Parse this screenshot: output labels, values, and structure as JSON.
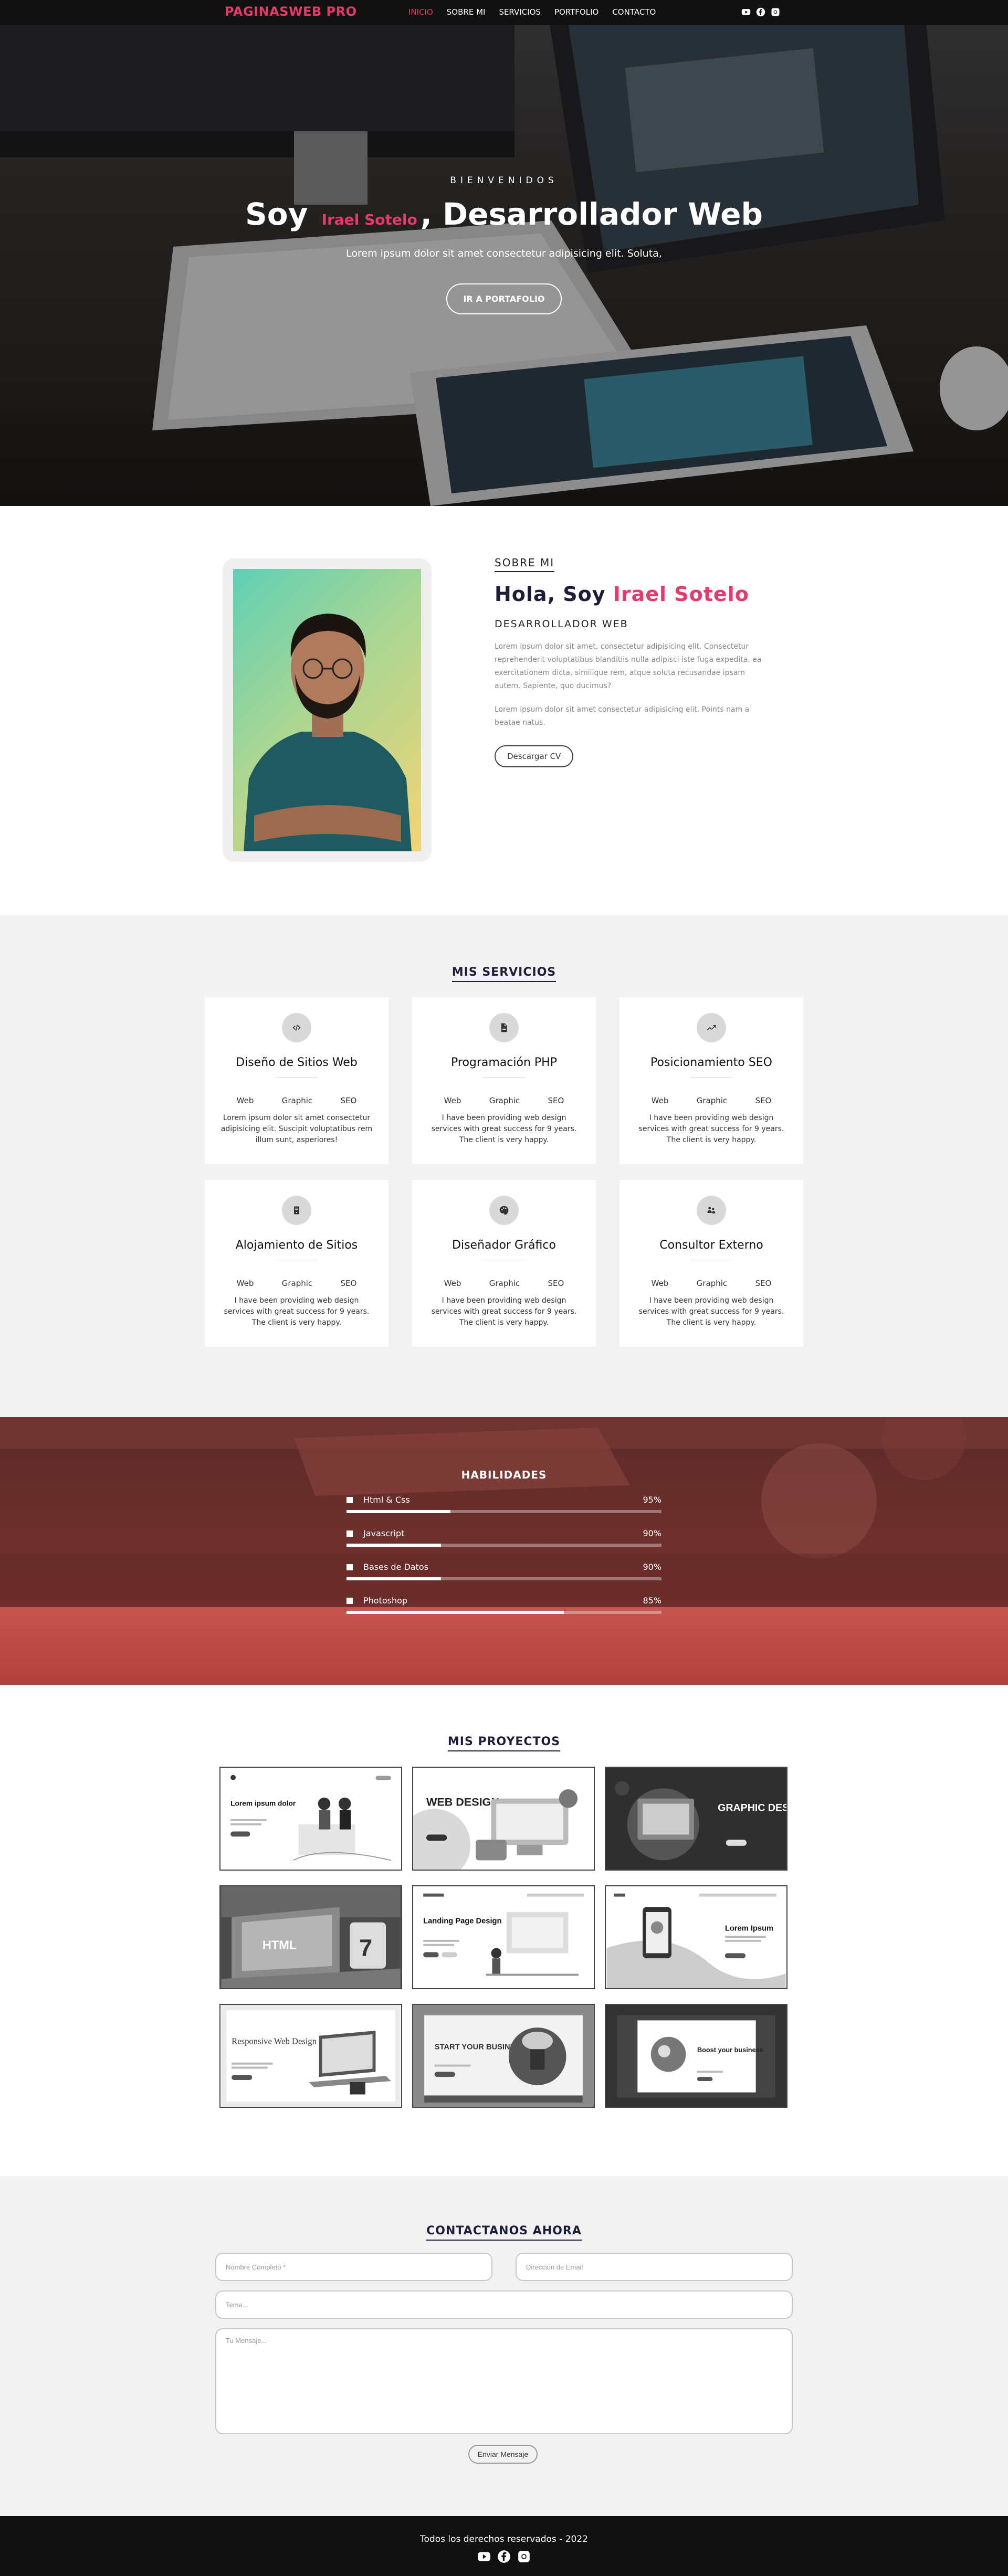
{
  "nav": {
    "brand": "PAGINASWEB PRO",
    "items": [
      {
        "label": "INICIO",
        "active": true
      },
      {
        "label": "SOBRE MI",
        "active": false
      },
      {
        "label": "SERVICIOS",
        "active": false
      },
      {
        "label": "PORTFOLIO",
        "active": false
      },
      {
        "label": "CONTACTO",
        "active": false
      }
    ],
    "social_icons": [
      "youtube-icon",
      "facebook-icon",
      "instagram-icon"
    ]
  },
  "hero": {
    "kicker": "BIENVENIDOS",
    "title_prefix": "Soy",
    "title_name": "Irael Sotelo",
    "title_suffix": ", Desarrollador Web",
    "subtitle": "Lorem ipsum dolor sit amet consectetur adipisicing elit. Soluta,",
    "button": "IR A PORTAFOLIO"
  },
  "about": {
    "kicker": "SOBRE MI",
    "hello_prefix": "Hola, Soy",
    "hello_name": "Irael Sotelo",
    "role": "DESARROLLADOR WEB",
    "paragraph1": "Lorem ipsum dolor sit amet, consectetur adipisicing elit. Consectetur reprehenderit voluptatibus blanditiis nulla adipisci iste fuga expedita, ea exercitationem dicta, similique rem, atque soluta recusandae ipsam autem. Sapiente, quo ducimus?",
    "paragraph2": "Lorem ipsum dolor sit amet consectetur adipisicing elit. Points nam a beatae natus.",
    "button": "Descargar CV"
  },
  "services": {
    "title": "MIS SERVICIOS",
    "items": [
      {
        "icon": "code-icon",
        "title": "Diseño de Sitios Web",
        "tags": [
          "Web",
          "Graphic",
          "SEO"
        ],
        "desc": "Lorem ipsum dolor sit amet consectetur adipisicing elit. Suscipit voluptatibus rem illum sunt, asperiores!"
      },
      {
        "icon": "file-icon",
        "title": "Programación PHP",
        "tags": [
          "Web",
          "Graphic",
          "SEO"
        ],
        "desc": "I have been providing web design services with great success for 9 years. The client is very happy."
      },
      {
        "icon": "trend-icon",
        "title": "Posicionamiento SEO",
        "tags": [
          "Web",
          "Graphic",
          "SEO"
        ],
        "desc": "I have been providing web design services with great success for 9 years. The client is very happy."
      },
      {
        "icon": "server-icon",
        "title": "Alojamiento de Sitios",
        "tags": [
          "Web",
          "Graphic",
          "SEO"
        ],
        "desc": "I have been providing web design services with great success for 9 years. The client is very happy."
      },
      {
        "icon": "palette-icon",
        "title": "Diseñador Gráfico",
        "tags": [
          "Web",
          "Graphic",
          "SEO"
        ],
        "desc": "I have been providing web design services with great success for 9 years. The client is very happy."
      },
      {
        "icon": "users-icon",
        "title": "Consultor Externo",
        "tags": [
          "Web",
          "Graphic",
          "SEO"
        ],
        "desc": "I have been providing web design services with great success for 9 years. The client is very happy."
      }
    ]
  },
  "skills": {
    "title": "HABILIDADES",
    "items": [
      {
        "label": "Html & Css",
        "value": "95%",
        "fraction": 0.33
      },
      {
        "label": "Javascript",
        "value": "90%",
        "fraction": 0.3
      },
      {
        "label": "Bases de Datos",
        "value": "90%",
        "fraction": 0.3
      },
      {
        "label": "Photoshop",
        "value": "85%",
        "fraction": 0.69
      }
    ]
  },
  "projects": {
    "title": "MIS PROYECTOS",
    "items": [
      {
        "heading": "Lorem ipsum dolor"
      },
      {
        "heading": "WEB DESIGN"
      },
      {
        "heading": "GRAPHIC DESIGN"
      },
      {
        "heading": "HTML"
      },
      {
        "heading": "Landing Page Design"
      },
      {
        "heading": "Lorem Ipsum"
      },
      {
        "heading": "Responsive Web Design"
      },
      {
        "heading": "START YOUR BUSINESS"
      },
      {
        "heading": "Boost your business"
      }
    ]
  },
  "contact": {
    "title": "CONTACTANOS AHORA",
    "name_placeholder": "Nombre Completo *",
    "email_placeholder": "Dirección de Email",
    "subject_placeholder": "Tema...",
    "message_placeholder": "Tu Mensaje...",
    "button": "Enviar Mensaje"
  },
  "footer": {
    "text": "Todos los derechos reservados - 2022",
    "social_icons": [
      "youtube-icon",
      "facebook-icon",
      "instagram-icon"
    ]
  }
}
